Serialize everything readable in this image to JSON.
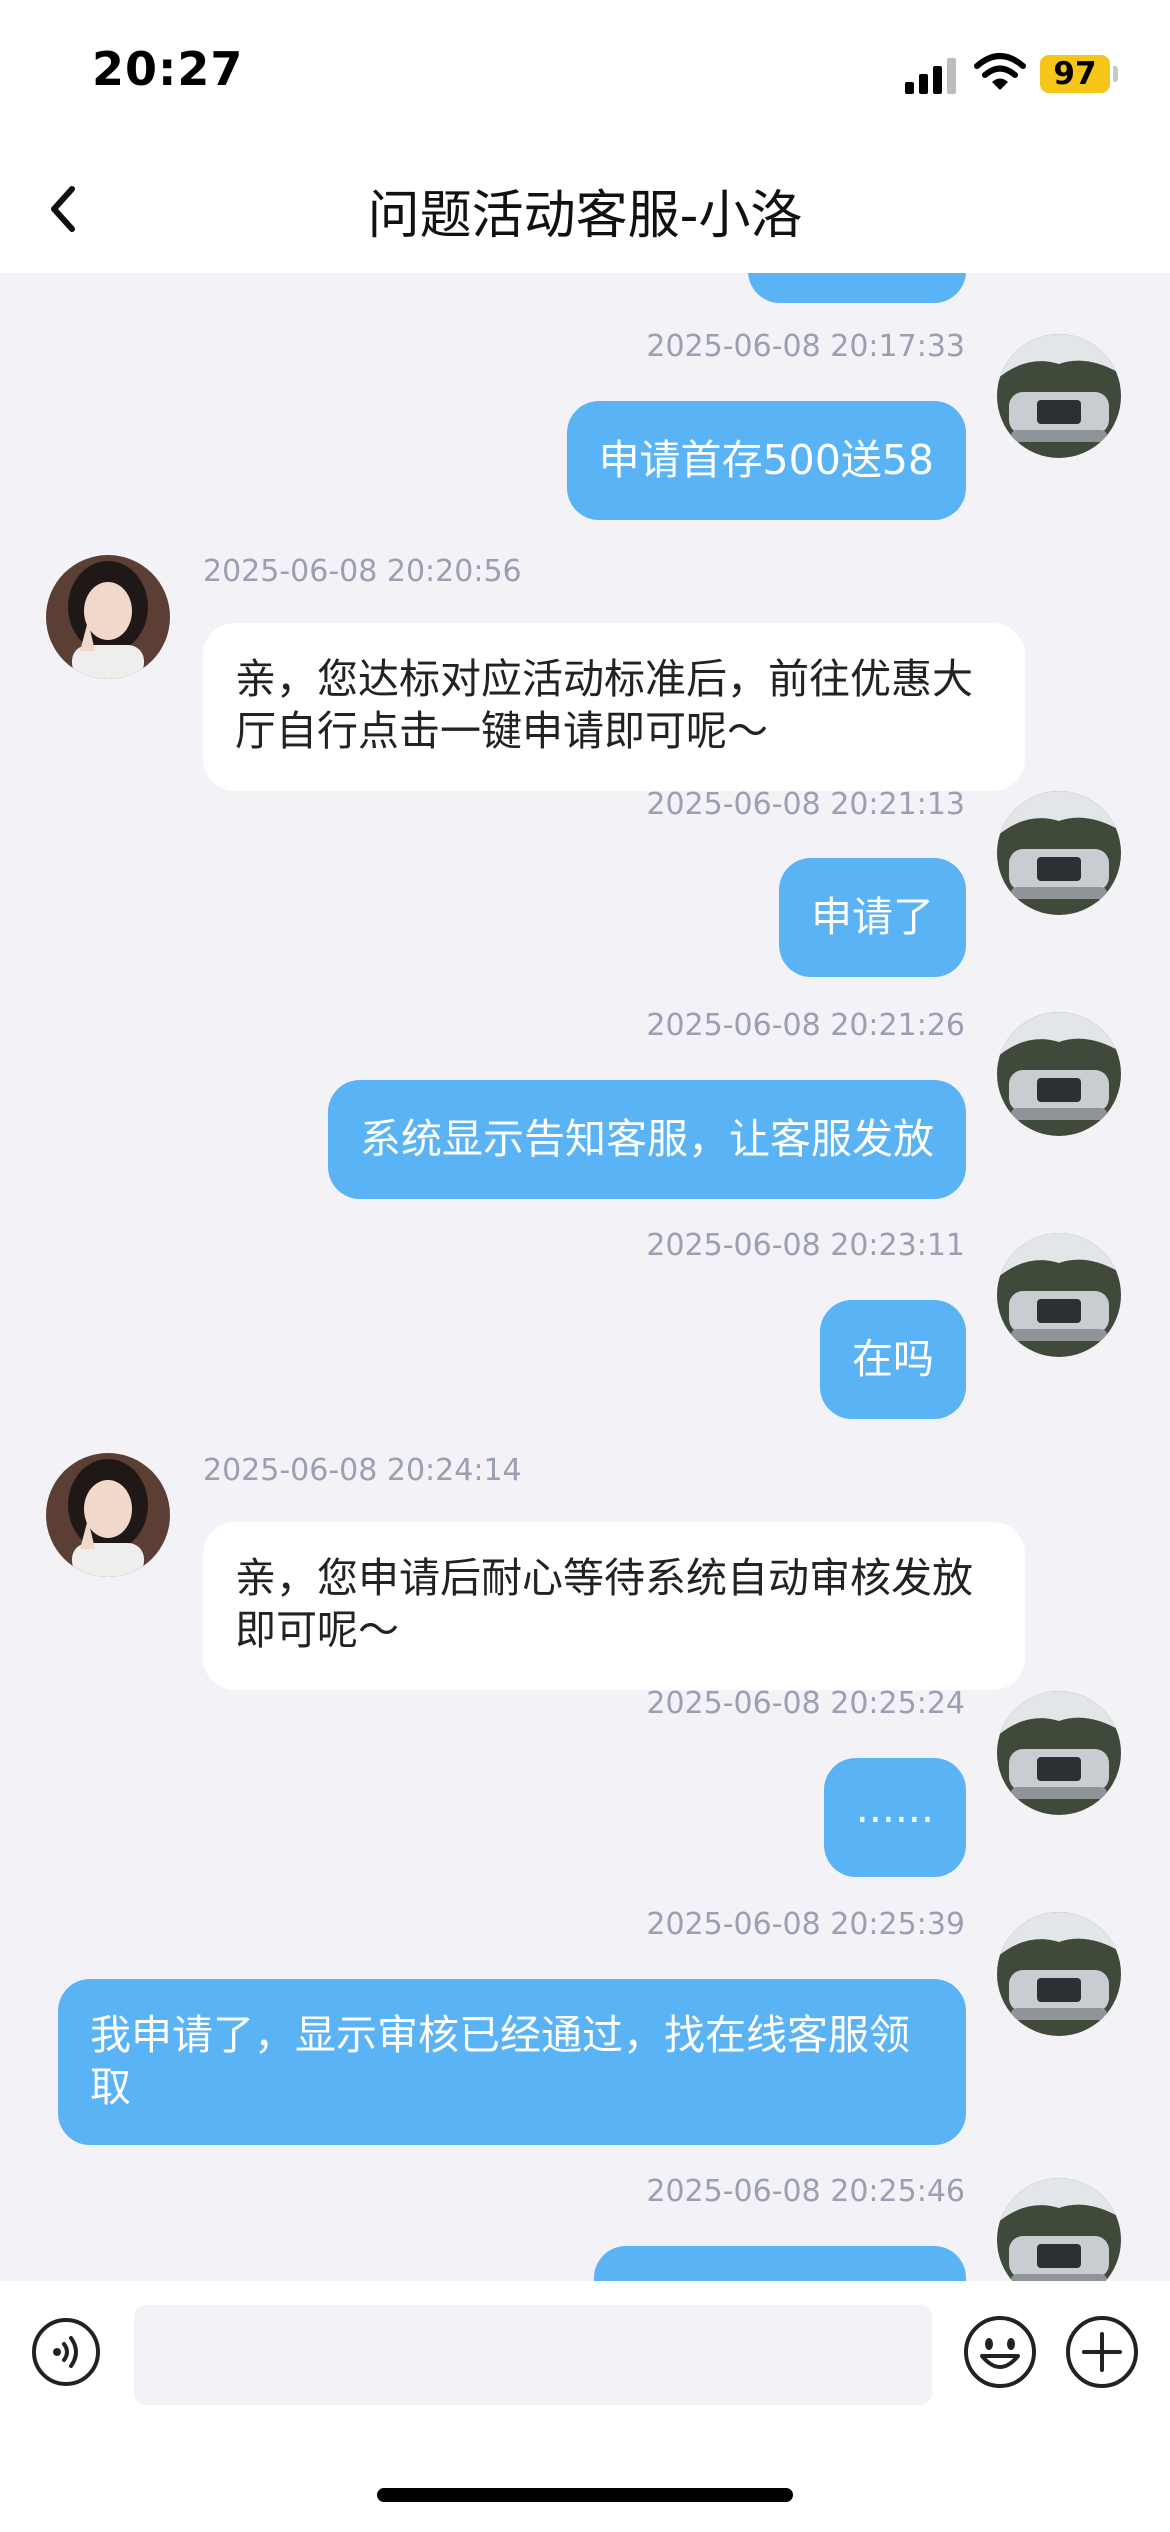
{
  "status_bar": {
    "time": "20:27",
    "battery": "97"
  },
  "header": {
    "title": "问题活动客服-小洛"
  },
  "messages": [
    {
      "sender": "me",
      "timestamp": "2025-06-08 20:17:33",
      "text": "申请首存500送58"
    },
    {
      "sender": "agent",
      "timestamp": "2025-06-08 20:20:56",
      "text": "亲，您达标对应活动标准后，前往优惠大厅自行点击一键申请即可呢～"
    },
    {
      "sender": "me",
      "timestamp": "2025-06-08 20:21:13",
      "text": "申请了"
    },
    {
      "sender": "me",
      "timestamp": "2025-06-08 20:21:26",
      "text": "系统显示告知客服，让客服发放"
    },
    {
      "sender": "me",
      "timestamp": "2025-06-08 20:23:11",
      "text": "在吗"
    },
    {
      "sender": "agent",
      "timestamp": "2025-06-08 20:24:14",
      "text": "亲，您申请后耐心等待系统自动审核发放即可呢～"
    },
    {
      "sender": "me",
      "timestamp": "2025-06-08 20:25:24",
      "text": "......"
    },
    {
      "sender": "me",
      "timestamp": "2025-06-08 20:25:39",
      "text": "我申请了，显示审核已经通过，找在线客服领取"
    },
    {
      "sender": "me",
      "timestamp": "2025-06-08 20:25:46",
      "text": ""
    }
  ],
  "input_bar": {
    "placeholder": ""
  },
  "icons": [
    "back-icon",
    "signal-icon",
    "wifi-icon",
    "battery-icon",
    "voice-icon",
    "emoji-icon",
    "plus-icon"
  ],
  "colors": {
    "my_bubble": "#5ab3f5",
    "agent_bubble": "#ffffff",
    "background": "#f2f2f7",
    "battery": "#f5c518"
  }
}
